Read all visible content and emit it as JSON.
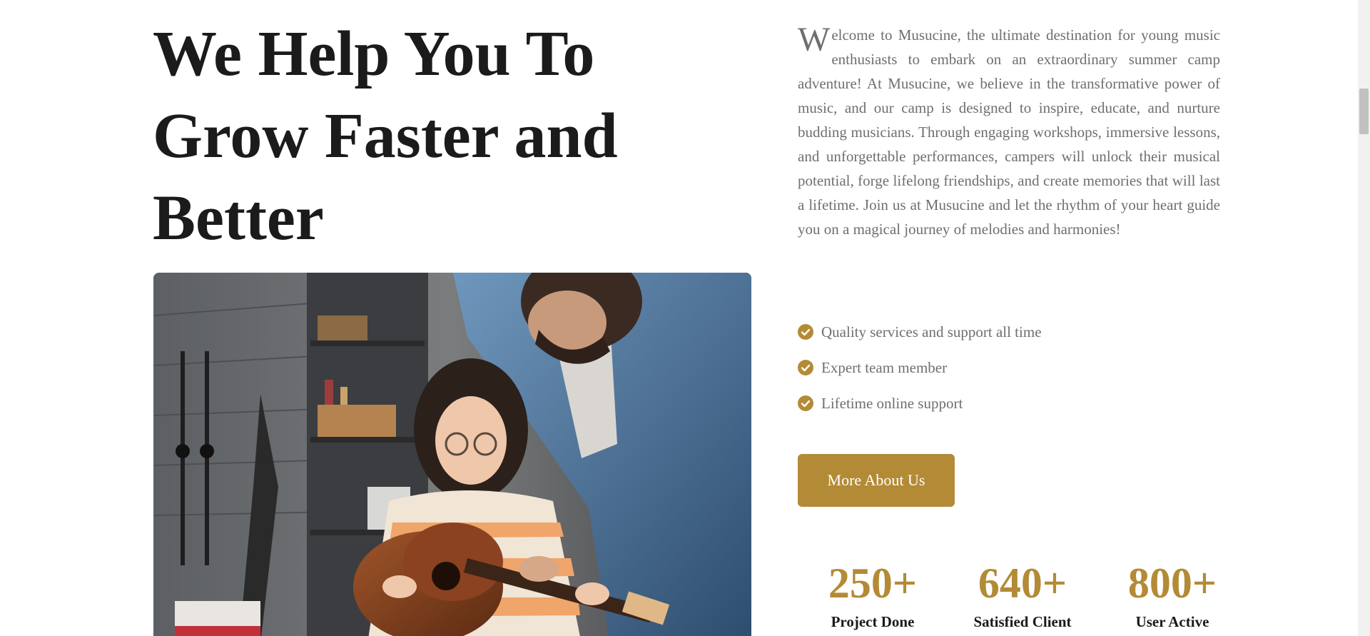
{
  "hero": {
    "title_lines": [
      "We Help You To",
      "Grow Faster and",
      "Better"
    ],
    "image_alt": "Man teaching a girl to play guitar"
  },
  "about": {
    "dropcap": "W",
    "intro_text": "elcome to Musucine, the ultimate destination for young music enthusiasts to embark on an extraordinary summer camp adventure! At Musucine, we believe in the transformative power of music, and our camp is designed to inspire, educate, and nurture budding musicians. Through engaging workshops, immersive lessons, and unforgettable performances, campers will unlock their musical potential, forge lifelong friendships, and create memories that will last a lifetime. Join us at Musucine and let the rhythm of your heart guide you on a magical journey of melodies and harmonies!",
    "features": [
      {
        "icon": "check-circle-icon",
        "label": "Quality services and support all time"
      },
      {
        "icon": "check-circle-icon",
        "label": "Expert team member"
      },
      {
        "icon": "check-circle-icon",
        "label": "Lifetime online support"
      }
    ],
    "button_label": "More About Us",
    "stats": [
      {
        "value": "250+",
        "label": "Project Done"
      },
      {
        "value": "640+",
        "label": "Satisfied Client"
      },
      {
        "value": "800+",
        "label": "User Active"
      }
    ]
  },
  "colors": {
    "accent": "#b38b36",
    "heading": "#1b1b1b",
    "body_text": "#6f6f6f"
  }
}
